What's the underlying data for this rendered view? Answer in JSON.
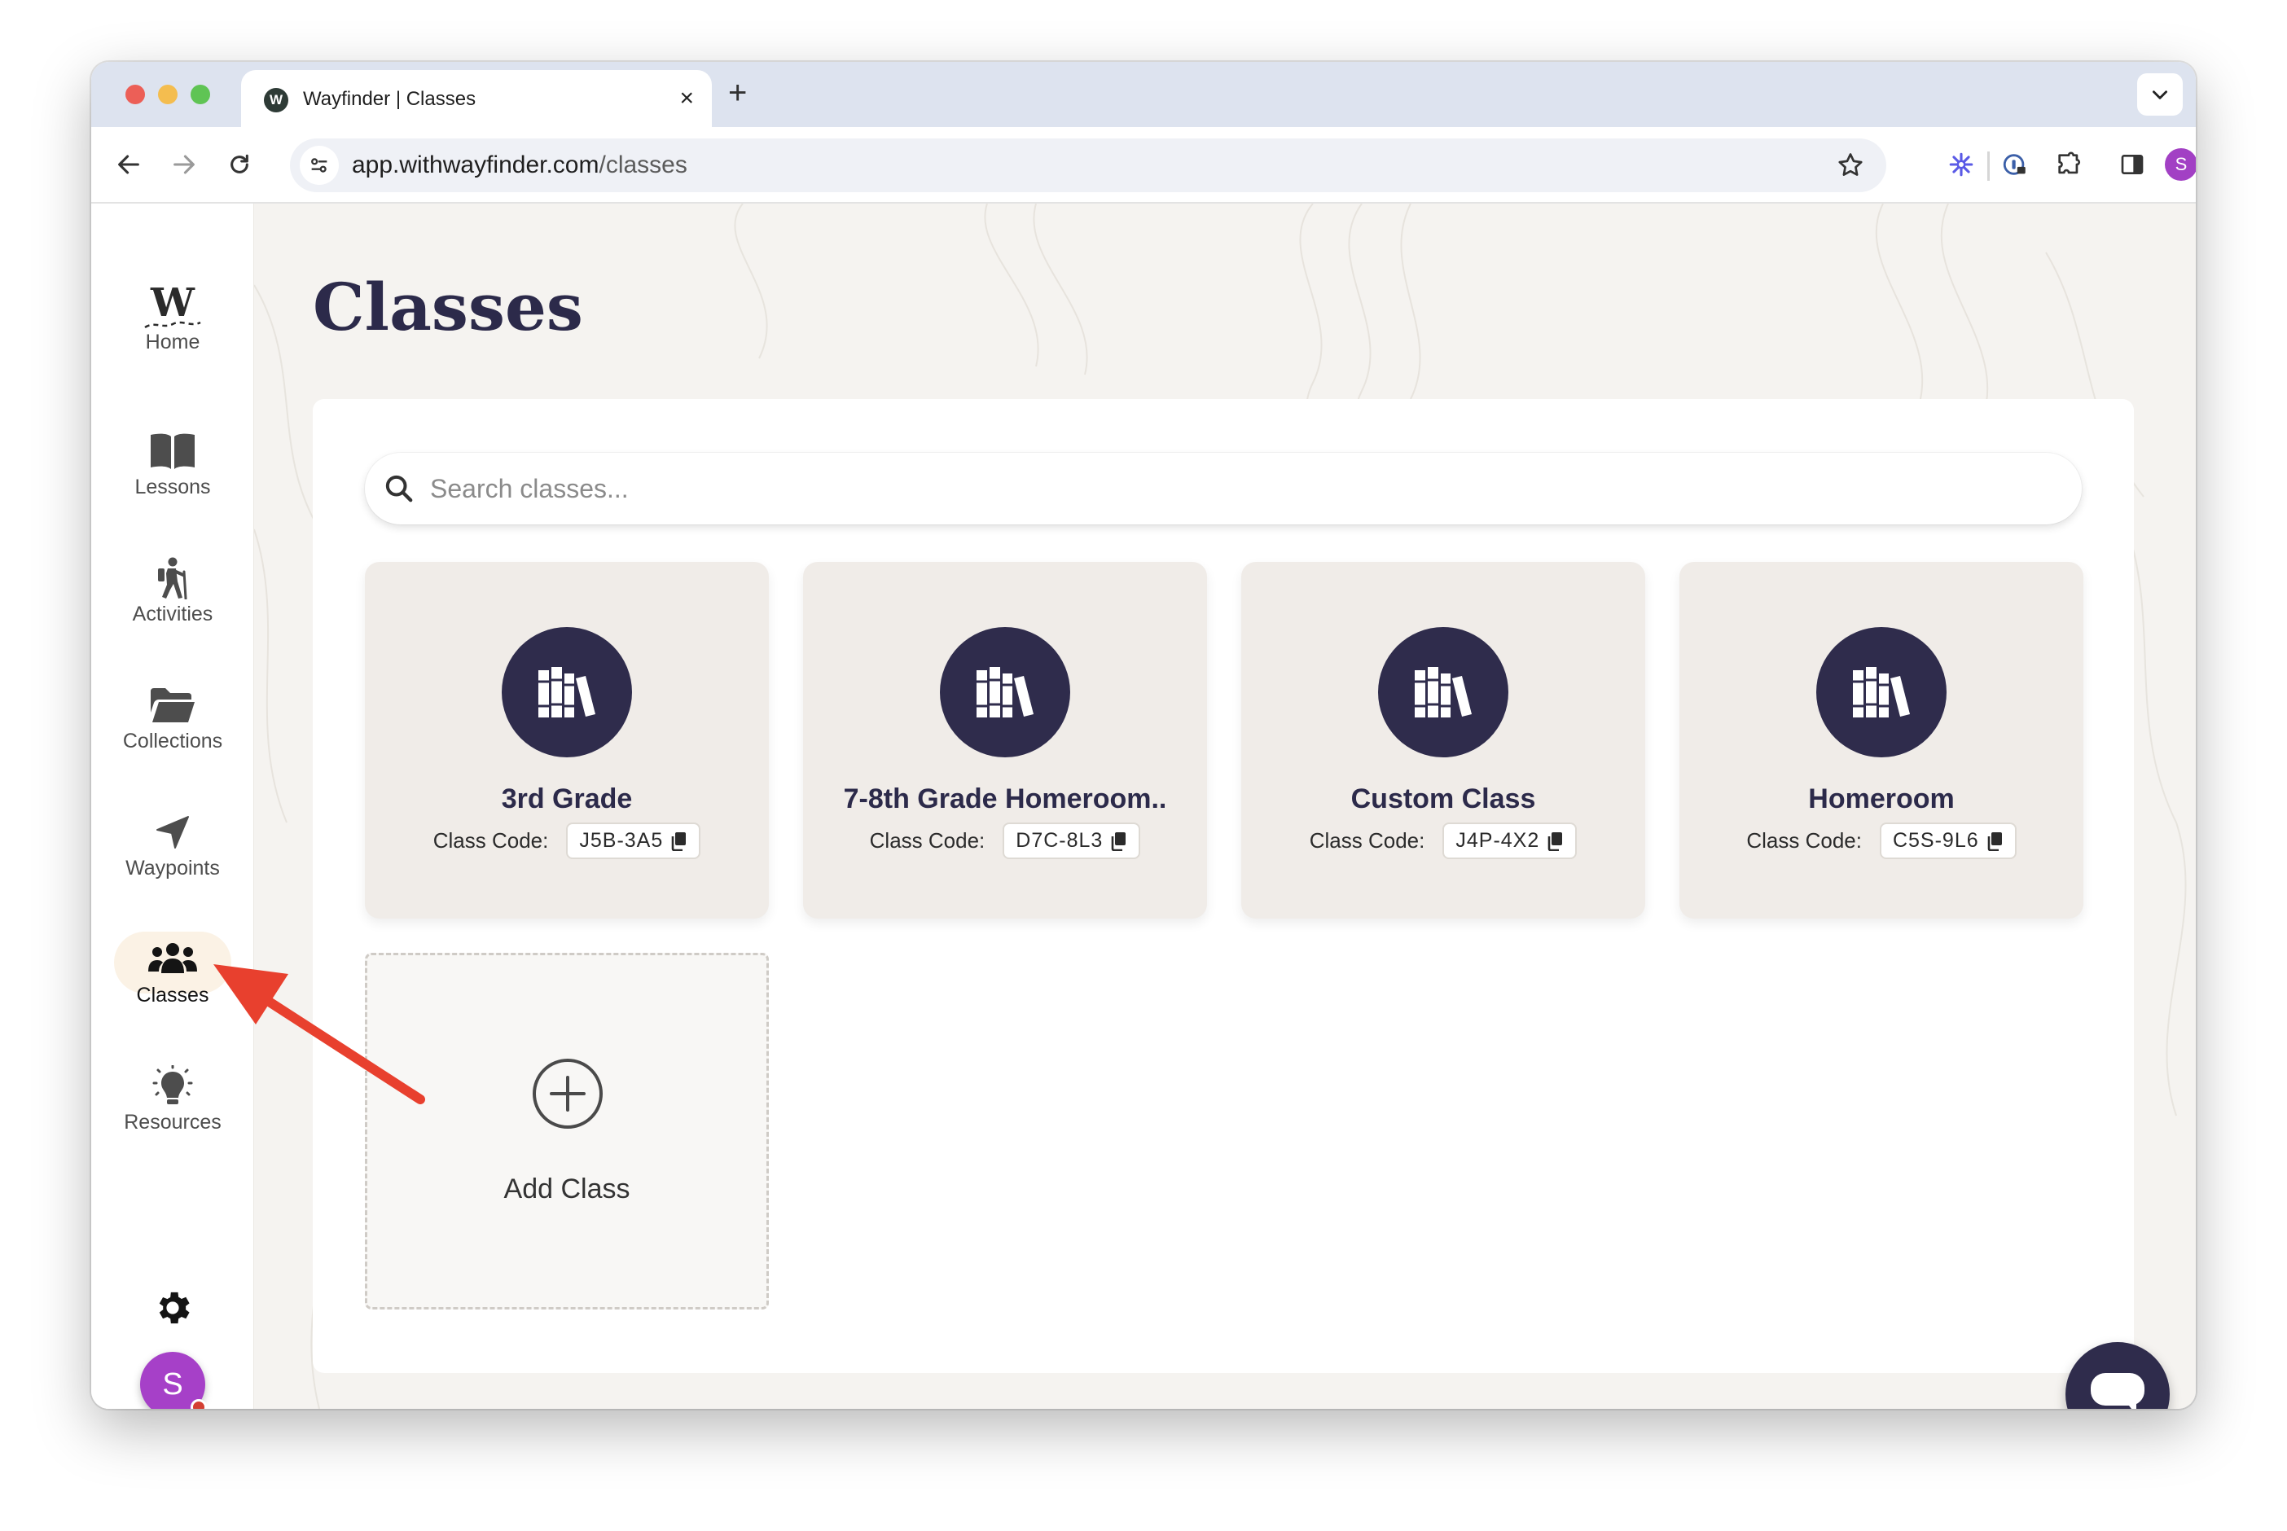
{
  "browser": {
    "tab_title": "Wayfinder | Classes",
    "favicon_letter": "W",
    "close_glyph": "×",
    "new_tab_glyph": "+",
    "url_domain": "app.withwayfinder.com",
    "url_path": "/classes",
    "profile_initial": "S"
  },
  "sidebar": {
    "items": [
      {
        "label": "Home",
        "icon": "wayfinder-logo-icon"
      },
      {
        "label": "Lessons",
        "icon": "book-icon"
      },
      {
        "label": "Activities",
        "icon": "hiker-icon"
      },
      {
        "label": "Collections",
        "icon": "folder-icon"
      },
      {
        "label": "Waypoints",
        "icon": "location-arrow-icon"
      },
      {
        "label": "Classes",
        "icon": "users-icon",
        "active": true
      },
      {
        "label": "Resources",
        "icon": "lightbulb-icon"
      }
    ],
    "logo_letter": "W",
    "avatar_initial": "S"
  },
  "main": {
    "title": "Classes",
    "search_placeholder": "Search classes...",
    "code_label": "Class Code:",
    "classes": [
      {
        "name": "3rd Grade",
        "code": "J5B-3A5"
      },
      {
        "name": "7-8th Grade Homeroom..",
        "code": "D7C-8L3"
      },
      {
        "name": "Custom Class",
        "code": "J4P-4X2"
      },
      {
        "name": "Homeroom",
        "code": "C5S-9L6"
      }
    ],
    "add_class_label": "Add Class"
  },
  "colors": {
    "brand_navy": "#2f2c4c",
    "active_nav_bg": "#fbf2e5",
    "annotation_arrow": "#e8402e",
    "avatar": "#a640c8"
  }
}
